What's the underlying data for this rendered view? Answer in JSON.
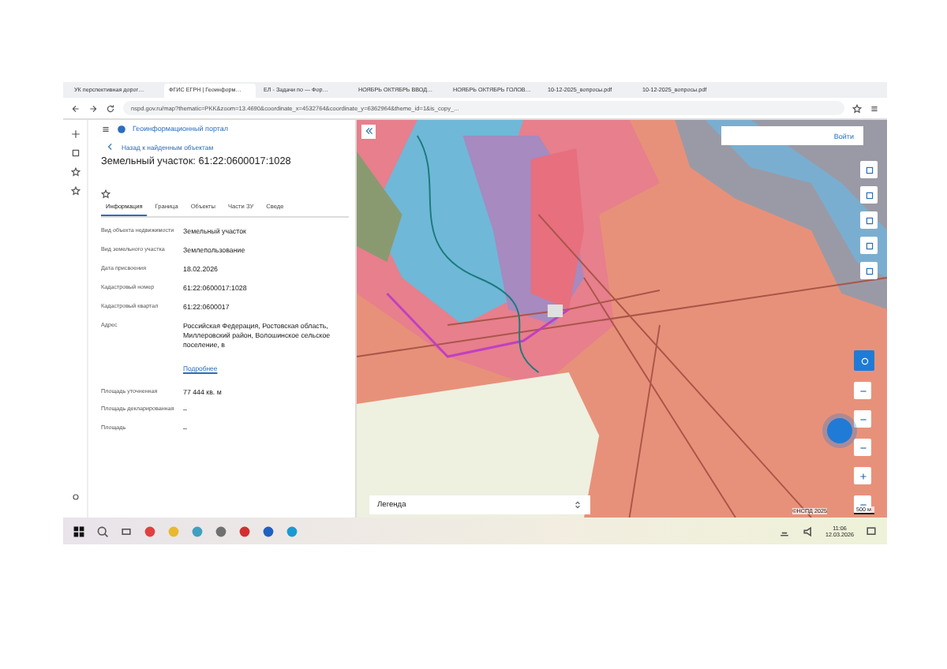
{
  "browser": {
    "tabs": [
      {
        "title": "УК перспективная дорог…",
        "selected": false
      },
      {
        "title": "ФГИС ЕГРН | Геоинформ…",
        "selected": true
      },
      {
        "title": "ЕЛ - Задачи по — Фор…",
        "selected": false
      },
      {
        "title": "НОЯБРЬ ОКТЯБРЬ ВВОД…",
        "selected": false
      },
      {
        "title": "НОЯБРЬ ОКТЯБРЬ ГОЛОВ…",
        "selected": false
      },
      {
        "title": "10-12-2025_вопросы.pdf",
        "selected": false
      },
      {
        "title": "10-12-2025_вопросы.pdf",
        "selected": false
      }
    ],
    "address": "nspd.gov.ru/map?thematic=PKK&zoom=13.4690&coordinate_x=4532764&coordinate_y=6362964&theme_id=1&is_copy_..."
  },
  "portal": {
    "title": "Геоинформационный портал",
    "back_link": "Назад к найденным объектам",
    "heading": "Земельный участок: 61:22:0600017:1028",
    "tabs": [
      {
        "label": "Информация",
        "selected": true
      },
      {
        "label": "Граница",
        "selected": false
      },
      {
        "label": "Объекты",
        "selected": false
      },
      {
        "label": "Части ЗУ",
        "selected": false
      },
      {
        "label": "Сведе",
        "selected": false
      }
    ],
    "fields": [
      {
        "label": "Вид объекта недвижимости",
        "value": "Земельный участок"
      },
      {
        "label": "Вид земельного участка",
        "value": "Землепользование"
      },
      {
        "label": "Дата присвоения",
        "value": "18.02.2026"
      },
      {
        "label": "Кадастровый номер",
        "value": "61:22:0600017:1028"
      },
      {
        "label": "Кадастровый квартал",
        "value": "61:22:0600017"
      },
      {
        "label": "Адрес",
        "value": "Российская Федерация, Ростовская область, Миллеровский район, Волошинское сельское поселение, в",
        "link": "Подробнее"
      },
      {
        "label": "Площадь уточненная",
        "value": "77 444 кв. м"
      },
      {
        "label": "Площадь декларированная",
        "value": "–"
      },
      {
        "label": "Площадь",
        "value": "–"
      }
    ]
  },
  "map": {
    "login_button": "Войти",
    "legend": "Легенда",
    "attribution": "©НСПД 2025",
    "scale": "500 м"
  },
  "taskbar": {
    "time": "11:06",
    "date": "12.03.2026"
  }
}
